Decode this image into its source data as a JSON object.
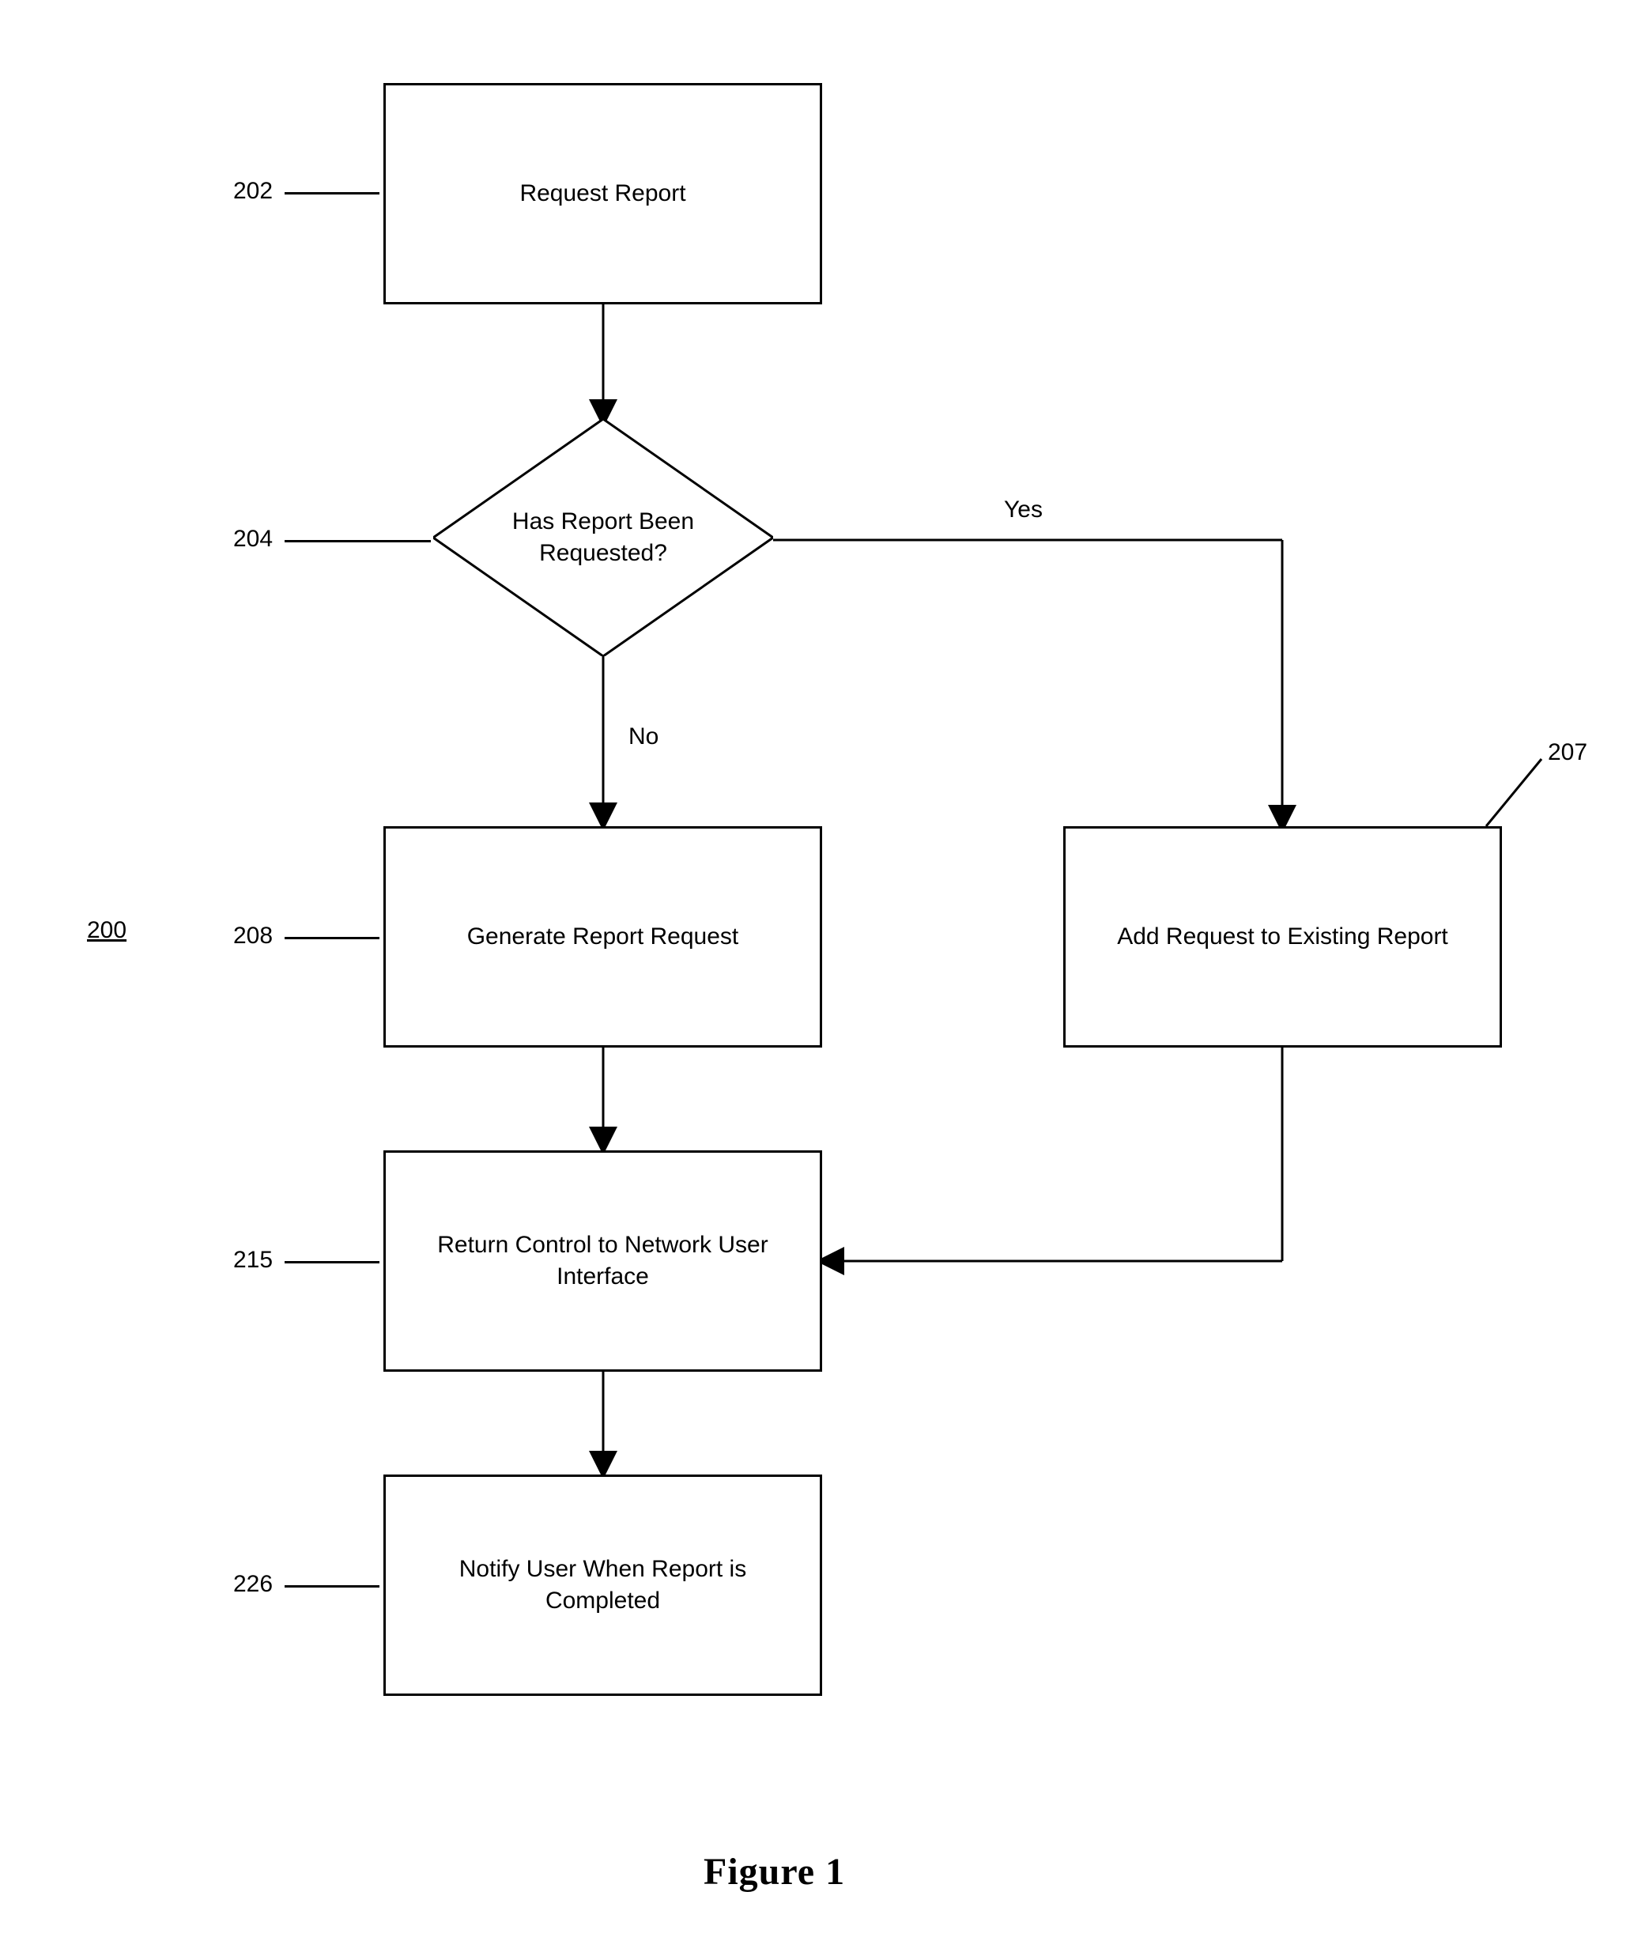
{
  "figure_label": "Figure 1",
  "diagram_ref": "200",
  "nodes": {
    "n202": {
      "ref": "202",
      "text": "Request Report"
    },
    "n204": {
      "ref": "204",
      "text": "Has Report Been Requested?"
    },
    "n207": {
      "ref": "207",
      "text": "Add Request to Existing Report"
    },
    "n208": {
      "ref": "208",
      "text": "Generate Report Request"
    },
    "n215": {
      "ref": "215",
      "text": "Return Control to Network User Interface"
    },
    "n226": {
      "ref": "226",
      "text": "Notify User When Report is Completed"
    }
  },
  "edges": {
    "yes": "Yes",
    "no": "No"
  }
}
